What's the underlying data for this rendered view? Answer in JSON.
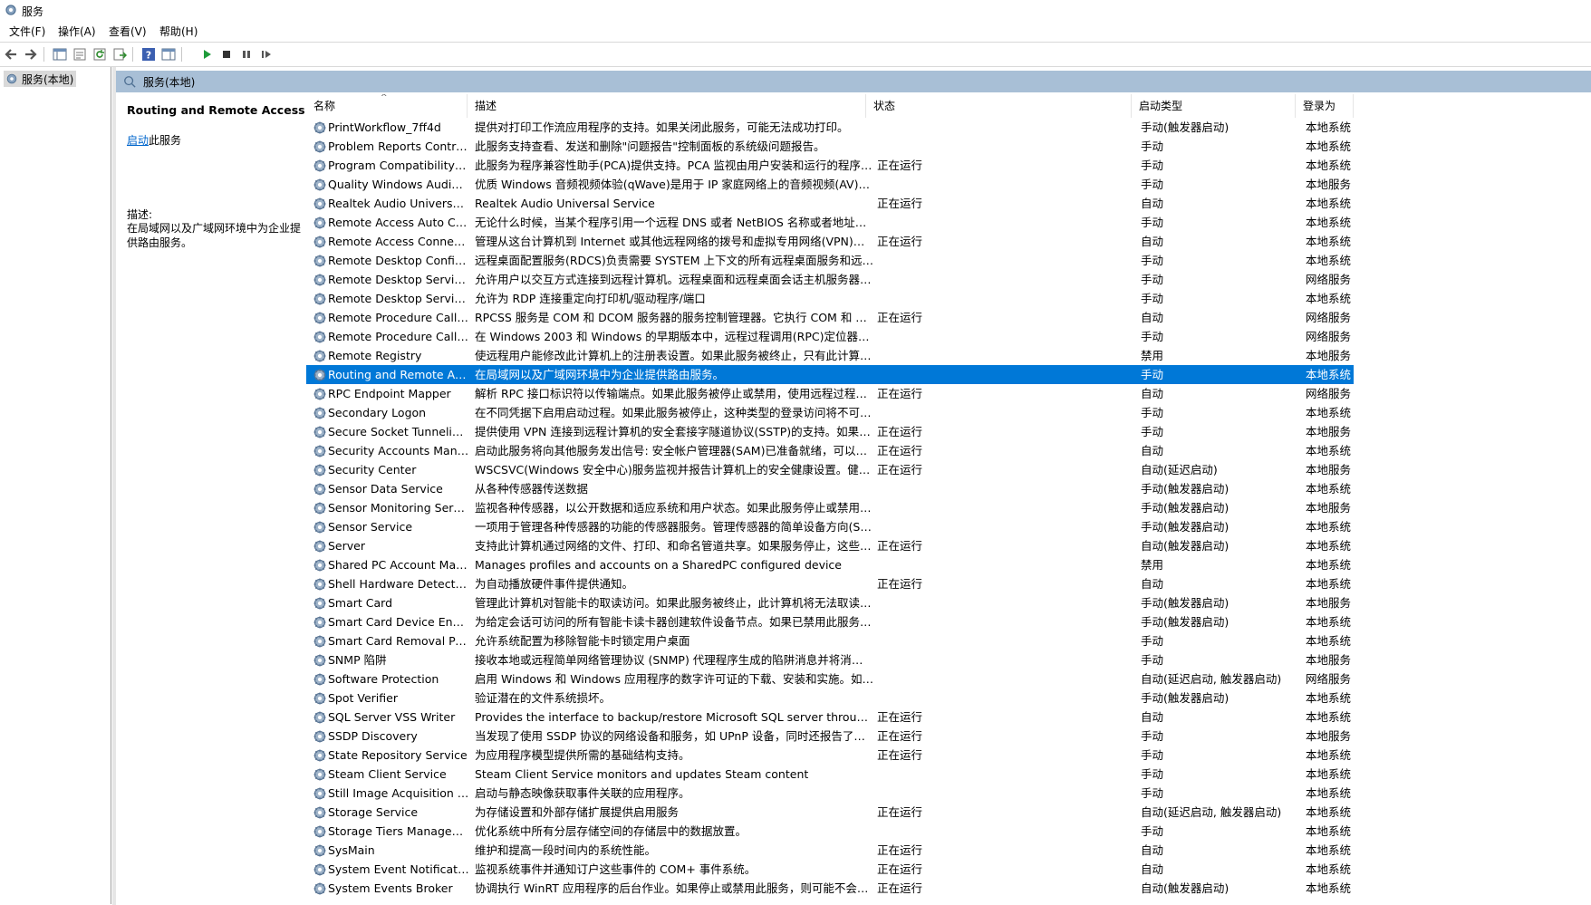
{
  "window": {
    "title": "服务"
  },
  "menu": [
    "文件(F)",
    "操作(A)",
    "查看(V)",
    "帮助(H)"
  ],
  "toolbar": {
    "icons": [
      "back-arrow-icon",
      "forward-arrow-icon",
      "console-tree-icon",
      "properties-icon",
      "refresh-icon",
      "export-icon",
      "help-icon",
      "view-icon",
      "start-service-icon",
      "stop-service-icon",
      "pause-service-icon",
      "restart-service-icon"
    ]
  },
  "tree": {
    "root_label": "服务(本地)"
  },
  "header": {
    "title": "服务(本地)"
  },
  "details": {
    "service_title": "Routing and Remote Access",
    "action_link": "启动",
    "action_suffix": "此服务",
    "description_label": "描述:",
    "description_text": "在局域网以及广域网环境中为企业提供路由服务。"
  },
  "columns": {
    "name": "名称",
    "description": "描述",
    "status": "状态",
    "startup": "启动类型",
    "logon": "登录为"
  },
  "accent_color": "#0078d7",
  "selected_index": 13,
  "services": [
    {
      "name": "PrintWorkflow_7ff4d",
      "desc": "提供对打印工作流应用程序的支持。如果关闭此服务，可能无法成功打印。",
      "status": "",
      "startup": "手动(触发器启动)",
      "logon": "本地系统"
    },
    {
      "name": "Problem Reports Control...",
      "desc": "此服务支持查看、发送和删除\"问题报告\"控制面板的系统级问题报告。",
      "status": "",
      "startup": "手动",
      "logon": "本地系统"
    },
    {
      "name": "Program Compatibility A...",
      "desc": "此服务为程序兼容性助手(PCA)提供支持。PCA 监视由用户安装和运行的程序，...",
      "status": "正在运行",
      "startup": "手动",
      "logon": "本地系统"
    },
    {
      "name": "Quality Windows Audio V...",
      "desc": "优质 Windows 音频视频体验(qWave)是用于 IP 家庭网络上的音频视频(AV)流应...",
      "status": "",
      "startup": "手动",
      "logon": "本地服务"
    },
    {
      "name": "Realtek Audio Universal ...",
      "desc": "Realtek Audio Universal Service",
      "status": "正在运行",
      "startup": "自动",
      "logon": "本地系统"
    },
    {
      "name": "Remote Access Auto Con...",
      "desc": "无论什么时候，当某个程序引用一个远程 DNS 或者 NetBIOS 名称或者地址，就...",
      "status": "",
      "startup": "手动",
      "logon": "本地系统"
    },
    {
      "name": "Remote Access Connecti...",
      "desc": "管理从这台计算机到 Internet 或其他远程网络的拨号和虚拟专用网络(VPN)连接...",
      "status": "正在运行",
      "startup": "自动",
      "logon": "本地系统"
    },
    {
      "name": "Remote Desktop Configu...",
      "desc": "远程桌面配置服务(RDCS)负责需要 SYSTEM 上下文的所有远程桌面服务和远程...",
      "status": "",
      "startup": "手动",
      "logon": "本地系统"
    },
    {
      "name": "Remote Desktop Services",
      "desc": "允许用户以交互方式连接到远程计算机。远程桌面和远程桌面会话主机服务器依...",
      "status": "",
      "startup": "手动",
      "logon": "网络服务"
    },
    {
      "name": "Remote Desktop Service...",
      "desc": "允许为 RDP 连接重定向打印机/驱动程序/端口",
      "status": "",
      "startup": "手动",
      "logon": "本地系统"
    },
    {
      "name": "Remote Procedure Call (...",
      "desc": "RPCSS 服务是 COM 和 DCOM 服务器的服务控制管理器。它执行 COM 和 DC...",
      "status": "正在运行",
      "startup": "自动",
      "logon": "网络服务"
    },
    {
      "name": "Remote Procedure Call (...",
      "desc": "在 Windows 2003 和 Windows 的早期版本中，远程过程调用(RPC)定位器服务...",
      "status": "",
      "startup": "手动",
      "logon": "网络服务"
    },
    {
      "name": "Remote Registry",
      "desc": "使远程用户能修改此计算机上的注册表设置。如果此服务被终止，只有此计算机...",
      "status": "",
      "startup": "禁用",
      "logon": "本地服务"
    },
    {
      "name": "Routing and Remote Acc...",
      "desc": "在局域网以及广域网环境中为企业提供路由服务。",
      "status": "",
      "startup": "手动",
      "logon": "本地系统"
    },
    {
      "name": "RPC Endpoint Mapper",
      "desc": "解析 RPC 接口标识符以传输端点。如果此服务被停止或禁用，使用远程过程调用...",
      "status": "正在运行",
      "startup": "自动",
      "logon": "网络服务"
    },
    {
      "name": "Secondary Logon",
      "desc": "在不同凭据下启用启动过程。如果此服务被停止，这种类型的登录访问将不可用...",
      "status": "",
      "startup": "手动",
      "logon": "本地系统"
    },
    {
      "name": "Secure Socket Tunneling ...",
      "desc": "提供使用 VPN 连接到远程计算机的安全套接字隧道协议(SSTP)的支持。如果该...",
      "status": "正在运行",
      "startup": "手动",
      "logon": "本地服务"
    },
    {
      "name": "Security Accounts Manag...",
      "desc": "启动此服务将向其他服务发出信号: 安全帐户管理器(SAM)已准备就绪，可以接受...",
      "status": "正在运行",
      "startup": "自动",
      "logon": "本地系统"
    },
    {
      "name": "Security Center",
      "desc": "WSCSVC(Windows 安全中心)服务监视并报告计算机上的安全健康设置。健康设...",
      "status": "正在运行",
      "startup": "自动(延迟启动)",
      "logon": "本地服务"
    },
    {
      "name": "Sensor Data Service",
      "desc": "从各种传感器传送数据",
      "status": "",
      "startup": "手动(触发器启动)",
      "logon": "本地系统"
    },
    {
      "name": "Sensor Monitoring Service",
      "desc": "监视各种传感器，以公开数据和适应系统和用户状态。如果此服务停止或禁用，...",
      "status": "",
      "startup": "手动(触发器启动)",
      "logon": "本地服务"
    },
    {
      "name": "Sensor Service",
      "desc": "一项用于管理各种传感器的功能的传感器服务。管理传感器的简单设备方向(SDO...",
      "status": "",
      "startup": "手动(触发器启动)",
      "logon": "本地系统"
    },
    {
      "name": "Server",
      "desc": "支持此计算机通过网络的文件、打印、和命名管道共享。如果服务停止，这些功...",
      "status": "正在运行",
      "startup": "自动(触发器启动)",
      "logon": "本地系统"
    },
    {
      "name": "Shared PC Account Mana...",
      "desc": "Manages profiles and accounts on a SharedPC configured device",
      "status": "",
      "startup": "禁用",
      "logon": "本地系统"
    },
    {
      "name": "Shell Hardware Detection",
      "desc": "为自动播放硬件事件提供通知。",
      "status": "正在运行",
      "startup": "自动",
      "logon": "本地系统"
    },
    {
      "name": "Smart Card",
      "desc": "管理此计算机对智能卡的取读访问。如果此服务被终止，此计算机将无法取读智...",
      "status": "",
      "startup": "手动(触发器启动)",
      "logon": "本地服务"
    },
    {
      "name": "Smart Card Device Enum...",
      "desc": "为给定会话可访问的所有智能卡读卡器创建软件设备节点。如果已禁用此服务，...",
      "status": "",
      "startup": "手动(触发器启动)",
      "logon": "本地系统"
    },
    {
      "name": "Smart Card Removal Poli...",
      "desc": "允许系统配置为移除智能卡时锁定用户桌面",
      "status": "",
      "startup": "手动",
      "logon": "本地系统"
    },
    {
      "name": "SNMP 陷阱",
      "desc": "接收本地或远程简单网络管理协议 (SNMP) 代理程序生成的陷阱消息并将消息转...",
      "status": "",
      "startup": "手动",
      "logon": "本地服务"
    },
    {
      "name": "Software Protection",
      "desc": "启用 Windows 和 Windows 应用程序的数字许可证的下载、安装和实施。如果...",
      "status": "",
      "startup": "自动(延迟启动, 触发器启动)",
      "logon": "网络服务"
    },
    {
      "name": "Spot Verifier",
      "desc": "验证潜在的文件系统损坏。",
      "status": "",
      "startup": "手动(触发器启动)",
      "logon": "本地系统"
    },
    {
      "name": "SQL Server VSS Writer",
      "desc": "Provides the interface to backup/restore Microsoft SQL server through th...",
      "status": "正在运行",
      "startup": "自动",
      "logon": "本地系统"
    },
    {
      "name": "SSDP Discovery",
      "desc": "当发现了使用 SSDP 协议的网络设备和服务，如 UPnP 设备，同时还报告了运行...",
      "status": "正在运行",
      "startup": "手动",
      "logon": "本地服务"
    },
    {
      "name": "State Repository Service",
      "desc": "为应用程序模型提供所需的基础结构支持。",
      "status": "正在运行",
      "startup": "手动",
      "logon": "本地系统"
    },
    {
      "name": "Steam Client Service",
      "desc": "Steam Client Service monitors and updates Steam content",
      "status": "",
      "startup": "手动",
      "logon": "本地系统"
    },
    {
      "name": "Still Image Acquisition Ev...",
      "desc": "启动与静态映像获取事件关联的应用程序。",
      "status": "",
      "startup": "手动",
      "logon": "本地系统"
    },
    {
      "name": "Storage Service",
      "desc": "为存储设置和外部存储扩展提供启用服务",
      "status": "正在运行",
      "startup": "自动(延迟启动, 触发器启动)",
      "logon": "本地系统"
    },
    {
      "name": "Storage Tiers Managem...",
      "desc": "优化系统中所有分层存储空间的存储层中的数据放置。",
      "status": "",
      "startup": "手动",
      "logon": "本地系统"
    },
    {
      "name": "SysMain",
      "desc": "维护和提高一段时间内的系统性能。",
      "status": "正在运行",
      "startup": "自动",
      "logon": "本地系统"
    },
    {
      "name": "System Event Notification...",
      "desc": "监视系统事件并通知订户这些事件的 COM+ 事件系统。",
      "status": "正在运行",
      "startup": "自动",
      "logon": "本地系统"
    },
    {
      "name": "System Events Broker",
      "desc": "协调执行 WinRT 应用程序的后台作业。如果停止或禁用此服务，则可能不会触...",
      "status": "正在运行",
      "startup": "自动(触发器启动)",
      "logon": "本地系统"
    }
  ]
}
